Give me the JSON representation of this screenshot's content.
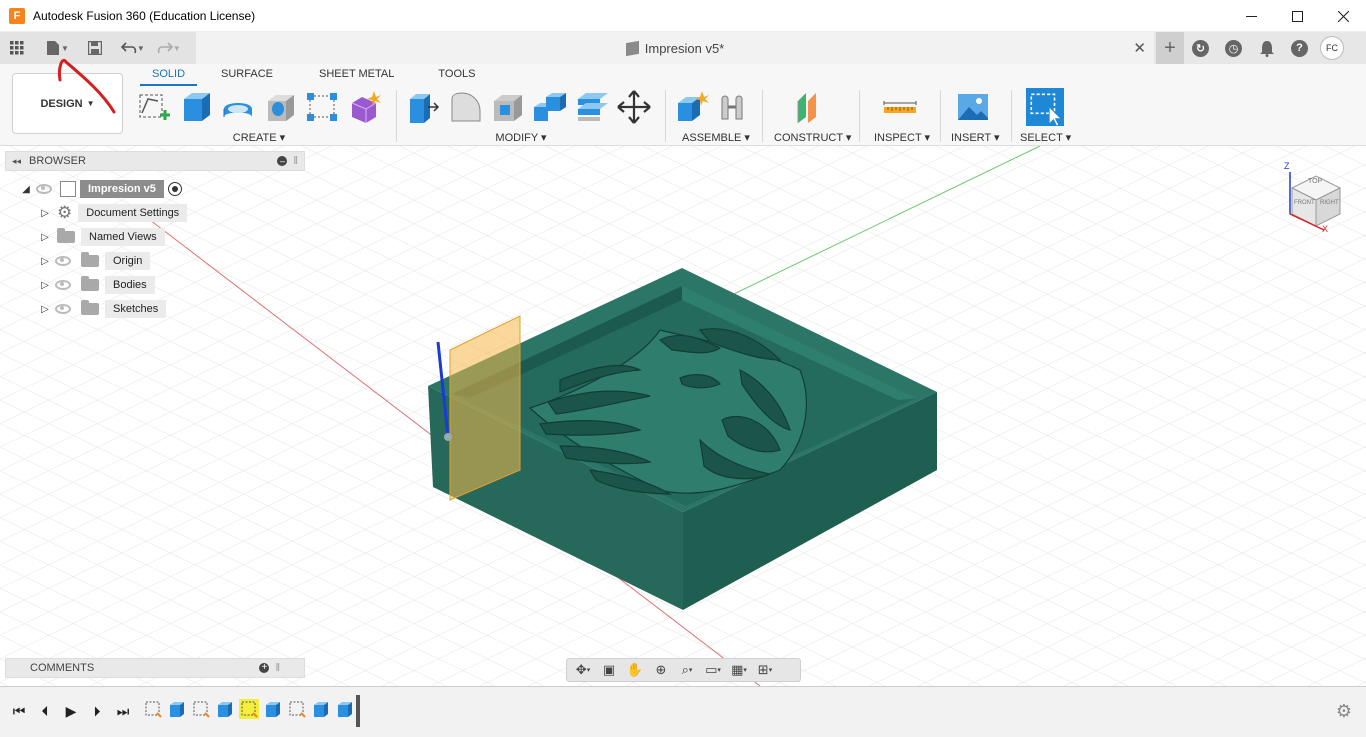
{
  "window": {
    "app_logo": "F",
    "title": "Autodesk Fusion 360 (Education License)",
    "minimize_icon": "minimize-icon",
    "maximize_icon": "maximize-icon",
    "close_icon": "close-icon"
  },
  "quick_access": {
    "doc_title": "Impresion v5*",
    "avatar": "FC"
  },
  "toolbar": {
    "workspace": "DESIGN",
    "tabs": [
      "SOLID",
      "SURFACE",
      "SHEET METAL",
      "TOOLS"
    ],
    "groups": {
      "create": "CREATE",
      "modify": "MODIFY",
      "assemble": "ASSEMBLE",
      "construct": "CONSTRUCT",
      "inspect": "INSPECT",
      "insert": "INSERT",
      "select": "SELECT"
    }
  },
  "browser": {
    "title": "BROWSER",
    "root": "Impresion v5",
    "items": [
      "Document Settings",
      "Named Views",
      "Origin",
      "Bodies",
      "Sketches"
    ]
  },
  "comments": {
    "title": "COMMENTS"
  },
  "viewcube": {
    "top": "TOP",
    "front": "FRONT",
    "right": "RIGHT",
    "z": "Z",
    "x": "X"
  },
  "colors": {
    "accent": "#1a74c0",
    "body": "#2f7a6b",
    "annotation": "#d42020"
  }
}
